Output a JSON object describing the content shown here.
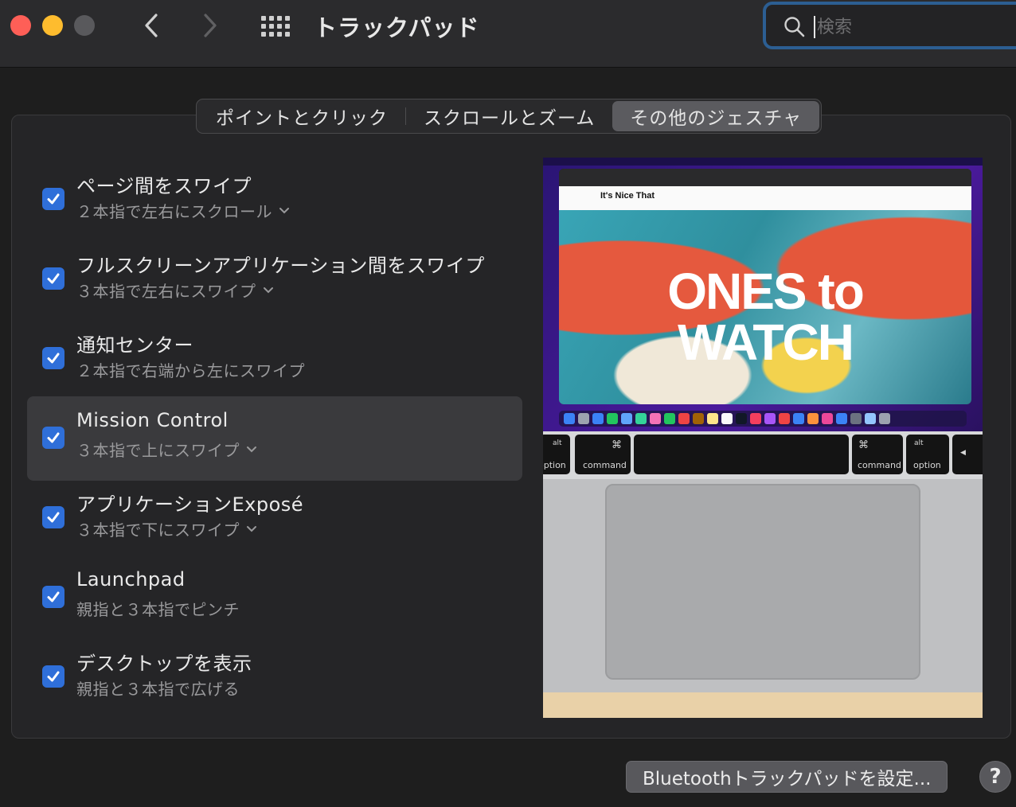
{
  "window": {
    "title": "トラックパッド",
    "search_placeholder": "検索"
  },
  "tabs": [
    {
      "label": "ポイントとクリック",
      "active": false
    },
    {
      "label": "スクロールとズーム",
      "active": false
    },
    {
      "label": "その他のジェスチャ",
      "active": true
    }
  ],
  "gestures": [
    {
      "title": "ページ間をスワイプ",
      "subtitle": "２本指で左右にスクロール",
      "checked": true,
      "has_dropdown": true
    },
    {
      "title": "フルスクリーンアプリケーション間をスワイプ",
      "subtitle": "３本指で左右にスワイプ",
      "checked": true,
      "has_dropdown": true
    },
    {
      "title": "通知センター",
      "subtitle": "２本指で右端から左にスワイプ",
      "checked": true,
      "has_dropdown": false
    },
    {
      "title": "Mission Control",
      "subtitle": "３本指で上にスワイプ",
      "checked": true,
      "has_dropdown": true,
      "selected": true
    },
    {
      "title": "アプリケーションExposé",
      "subtitle": "３本指で下にスワイプ",
      "checked": true,
      "has_dropdown": true
    },
    {
      "title": "Launchpad",
      "subtitle": "親指と３本指でピンチ",
      "checked": true,
      "has_dropdown": false
    },
    {
      "title": "デスクトップを表示",
      "subtitle": "親指と３本指で広げる",
      "checked": true,
      "has_dropdown": false
    }
  ],
  "preview": {
    "headline_line1": "ONES to",
    "headline_line2": "WATCH",
    "site_name": "It's Nice That",
    "keys": {
      "alt": "alt",
      "option": "option",
      "command": "command",
      "cmd_symbol": "⌘"
    }
  },
  "footer": {
    "bluetooth_button": "Bluetoothトラックパッドを設定...",
    "help_button": "?"
  },
  "colors": {
    "accent": "#2f6fd9",
    "search_focus": "#2c5e92",
    "close": "#fe5f57",
    "minimize": "#febc2e"
  }
}
